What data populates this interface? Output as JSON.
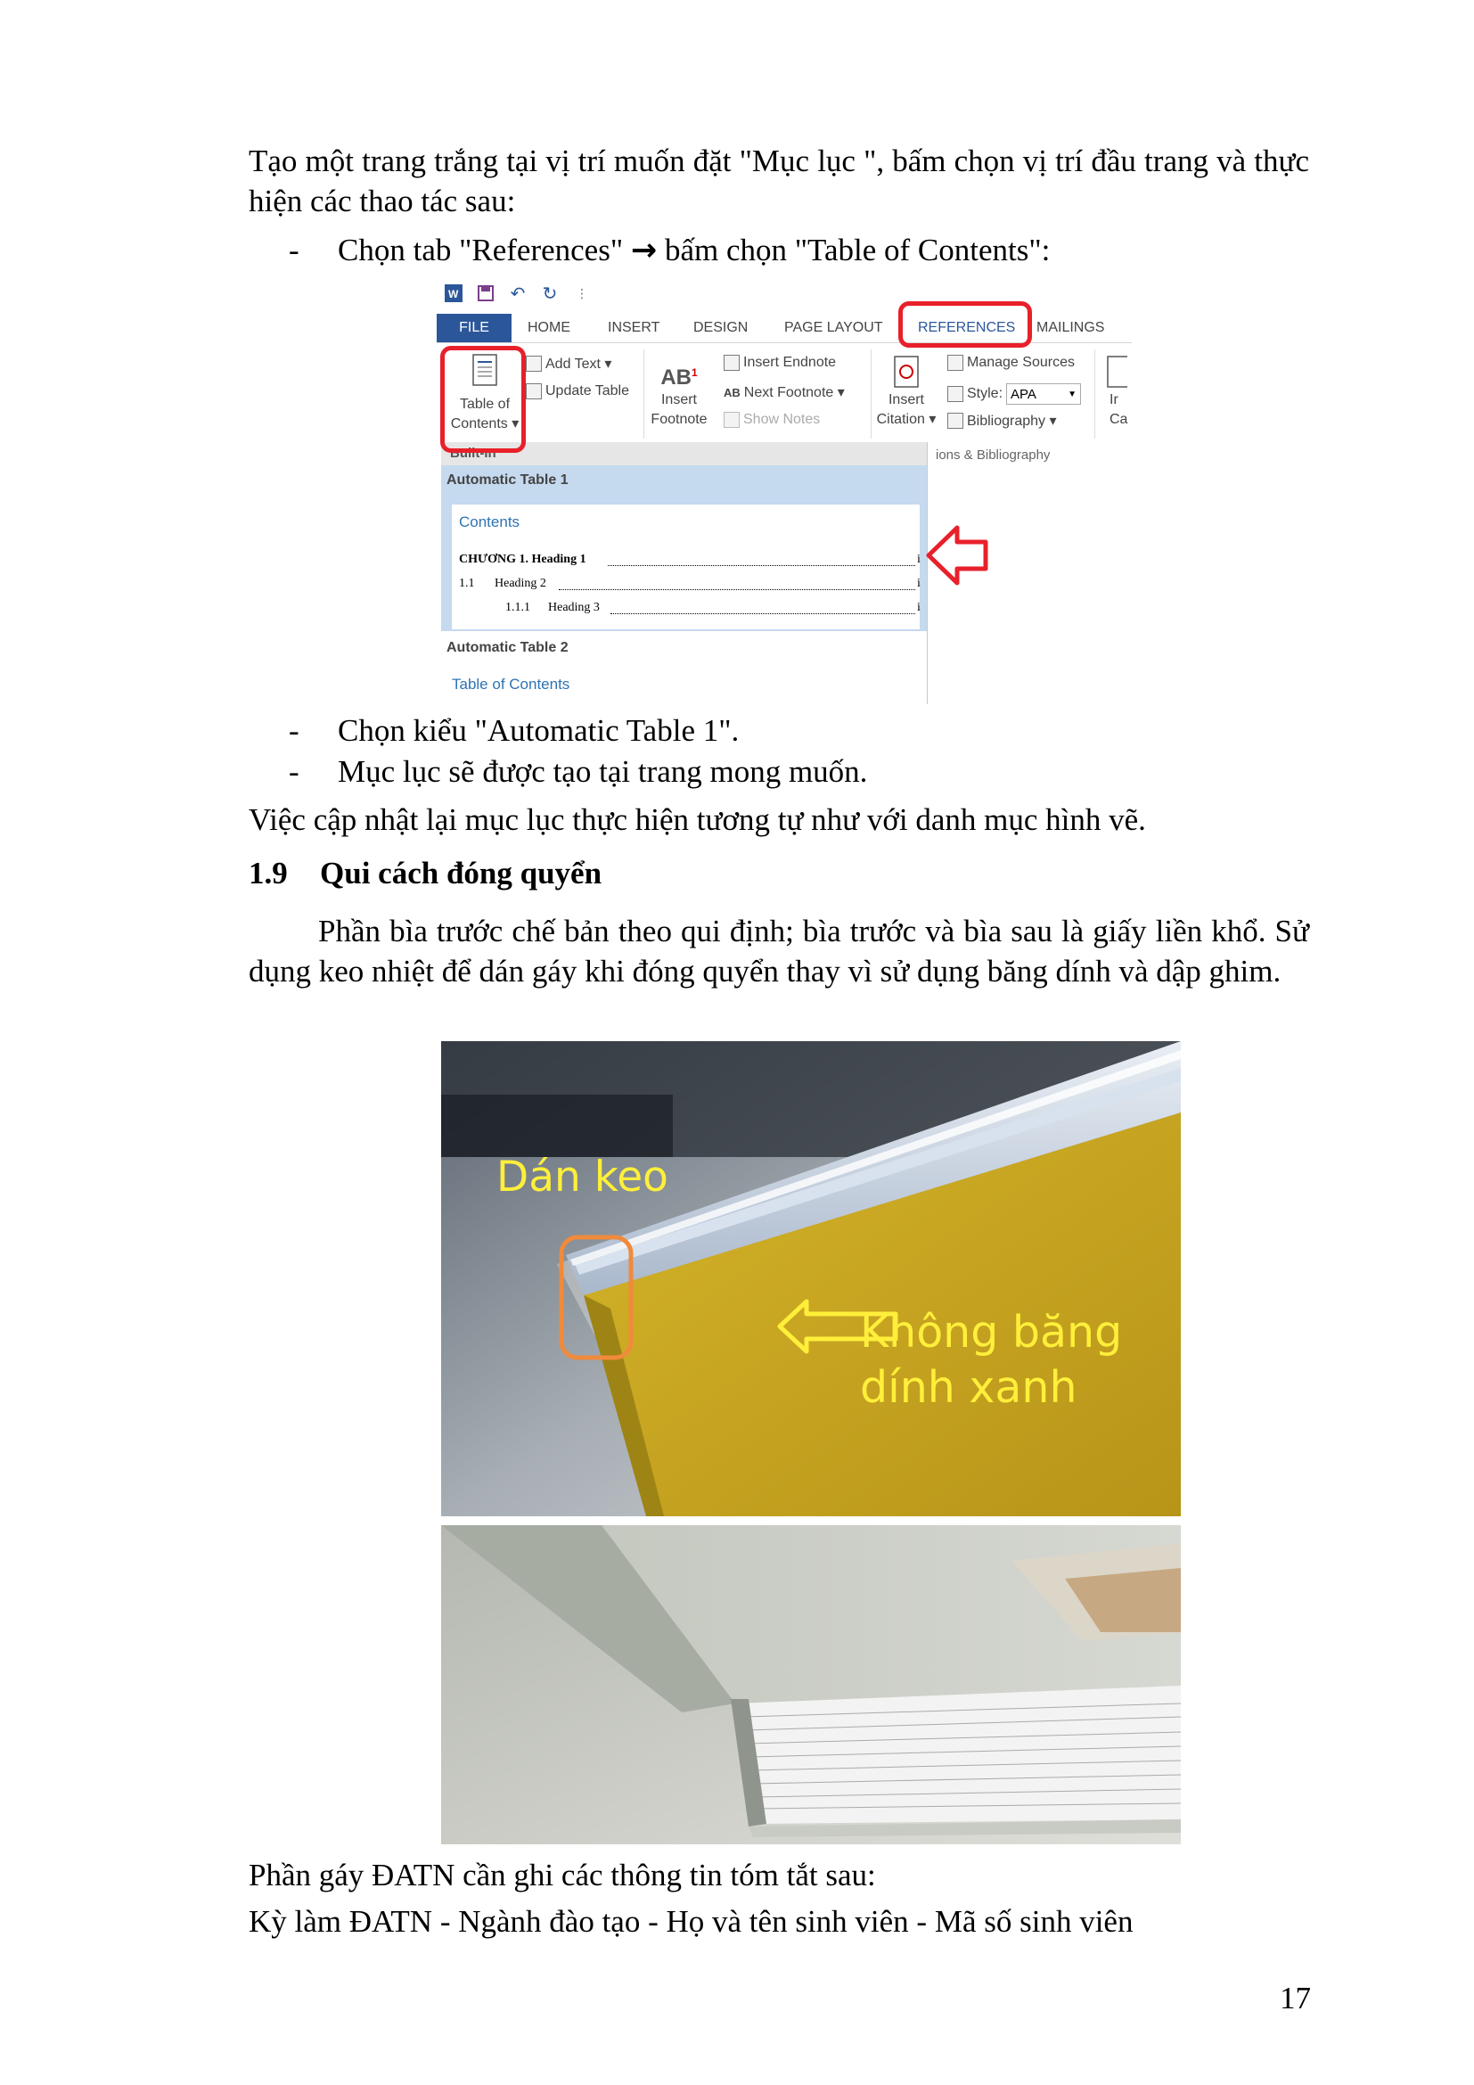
{
  "paragraphs": {
    "intro": "Tạo một trang trắng tại vị trí muốn đặt \"Mục lục \", bấm chọn vị trí đầu trang và thực hiện các thao tác sau:",
    "update_note": "Việc cập nhật lại mục lục thực hiện tương tự như với danh mục hình vẽ.",
    "binding_text": "Phần bìa trước chế bản theo qui định; bìa trước và bìa sau là giấy liền khổ. Sử dụng keo nhiệt để dán gáy khi đóng quyển thay vì sử dụng băng dính và dập ghim.",
    "spine_info": "Phần gáy ĐATN cần ghi các thông tin tóm tắt sau:",
    "spine_fields": "Kỳ làm ĐATN - Ngành đào tạo - Họ và tên sinh viên - Mã số sinh viên"
  },
  "bullets": {
    "dash": "-",
    "step1_before": "Chọn tab \"References\" ",
    "step1_arrow": "→",
    "step1_after": " bấm chọn \"Table of Contents\":",
    "step2": "Chọn kiểu \"Automatic Table 1\".",
    "step3": "Mục lục sẽ được tạo tại trang mong muốn."
  },
  "section": {
    "number": "1.9",
    "title": "Qui cách đóng quyển"
  },
  "page_number": "17",
  "ribbon": {
    "tabs": [
      "FILE",
      "HOME",
      "INSERT",
      "DESIGN",
      "PAGE LAYOUT",
      "REFERENCES",
      "MAILINGS"
    ],
    "toc_button": [
      "Table of",
      "Contents ▾"
    ],
    "add_text": "Add Text ▾",
    "update_table": "Update Table",
    "insert_footnote": [
      "Insert",
      "Footnote"
    ],
    "insert_endnote": "Insert Endnote",
    "next_footnote": "Next Footnote ▾",
    "show_notes": "Show Notes",
    "insert_citation": [
      "Insert",
      "Citation ▾"
    ],
    "manage_sources": "Manage Sources",
    "style_label": "Style:",
    "style_value": "APA",
    "bibliography": "Bibliography ▾",
    "group_label": "ions & Bibliography",
    "cut_label": [
      "Ir",
      "Ca"
    ],
    "builtin": "Built-In",
    "auto_table_1": "Automatic Table 1",
    "contents": "Contents",
    "toc_chapter": "CHƯƠNG 1. Heading 1",
    "toc_h2_num": "1.1",
    "toc_h2": "Heading 2",
    "toc_h3_num": "1.1.1",
    "toc_h3": "Heading 3",
    "toc_page": "i",
    "auto_table_2": "Automatic Table 2",
    "table_of_contents": "Table of Contents",
    "accent": "#2b579a",
    "highlight": "#e8202a"
  },
  "photo": {
    "label_glue": "Dán keo",
    "label_no_tape_1": "Không băng",
    "label_no_tape_2": "dính xanh",
    "label_color": "#ffef3a",
    "box_color": "#f08a3c"
  }
}
